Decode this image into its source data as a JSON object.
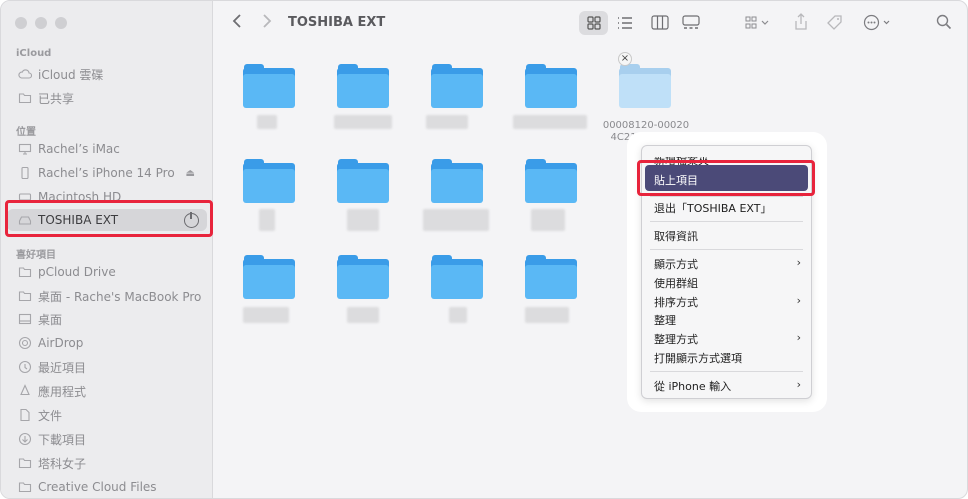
{
  "window": {
    "title": "TOSHIBA EXT"
  },
  "sidebar": {
    "sections": [
      {
        "title": "iCloud",
        "items": [
          {
            "label": "iCloud 雲碟",
            "icon": "cloud-icon"
          },
          {
            "label": "已共享",
            "icon": "shared-folder-icon"
          }
        ]
      },
      {
        "title": "位置",
        "items": [
          {
            "label": "Rachel’s iMac",
            "icon": "desktop-computer-icon"
          },
          {
            "label": "Rachel’s iPhone 14 Pro",
            "icon": "phone-icon"
          },
          {
            "label": "Macintosh HD",
            "icon": "hard-drive-icon"
          },
          {
            "label": "TOSHIBA EXT",
            "icon": "external-drive-icon",
            "selected": true
          }
        ]
      },
      {
        "title": "喜好項目",
        "items": [
          {
            "label": "pCloud Drive",
            "icon": "folder-icon"
          },
          {
            "label": "桌面 - Rache's MacBook Pro",
            "icon": "folder-icon"
          },
          {
            "label": "桌面",
            "icon": "desktop-icon"
          },
          {
            "label": "AirDrop",
            "icon": "airdrop-icon"
          },
          {
            "label": "最近項目",
            "icon": "clock-icon"
          },
          {
            "label": "應用程式",
            "icon": "apps-icon"
          },
          {
            "label": "文件",
            "icon": "document-icon"
          },
          {
            "label": "下載項目",
            "icon": "download-icon"
          },
          {
            "label": "塔科女子",
            "icon": "folder-icon"
          },
          {
            "label": "Creative Cloud Files",
            "icon": "folder-icon"
          }
        ]
      }
    ]
  },
  "content": {
    "dragged_item": {
      "name_line1": "00008120-00020",
      "name_line2": "4C21EEB401E"
    }
  },
  "context_menu": {
    "items": [
      {
        "label": "新增檔案夾"
      },
      {
        "label": "貼上項目",
        "highlighted": true
      },
      {
        "label": "退出「TOSHIBA EXT」"
      },
      {
        "label": "取得資訊"
      },
      {
        "label": "顯示方式",
        "submenu": true
      },
      {
        "label": "使用群組"
      },
      {
        "label": "排序方式",
        "submenu": true
      },
      {
        "label": "整理"
      },
      {
        "label": "整理方式",
        "submenu": true
      },
      {
        "label": "打開顯示方式選項"
      },
      {
        "label": "從 iPhone 輸入",
        "submenu": true
      }
    ]
  },
  "colors": {
    "highlight_border": "#e8243c",
    "menu_selection": "#4b4a78",
    "folder": "#5ab8f5"
  }
}
